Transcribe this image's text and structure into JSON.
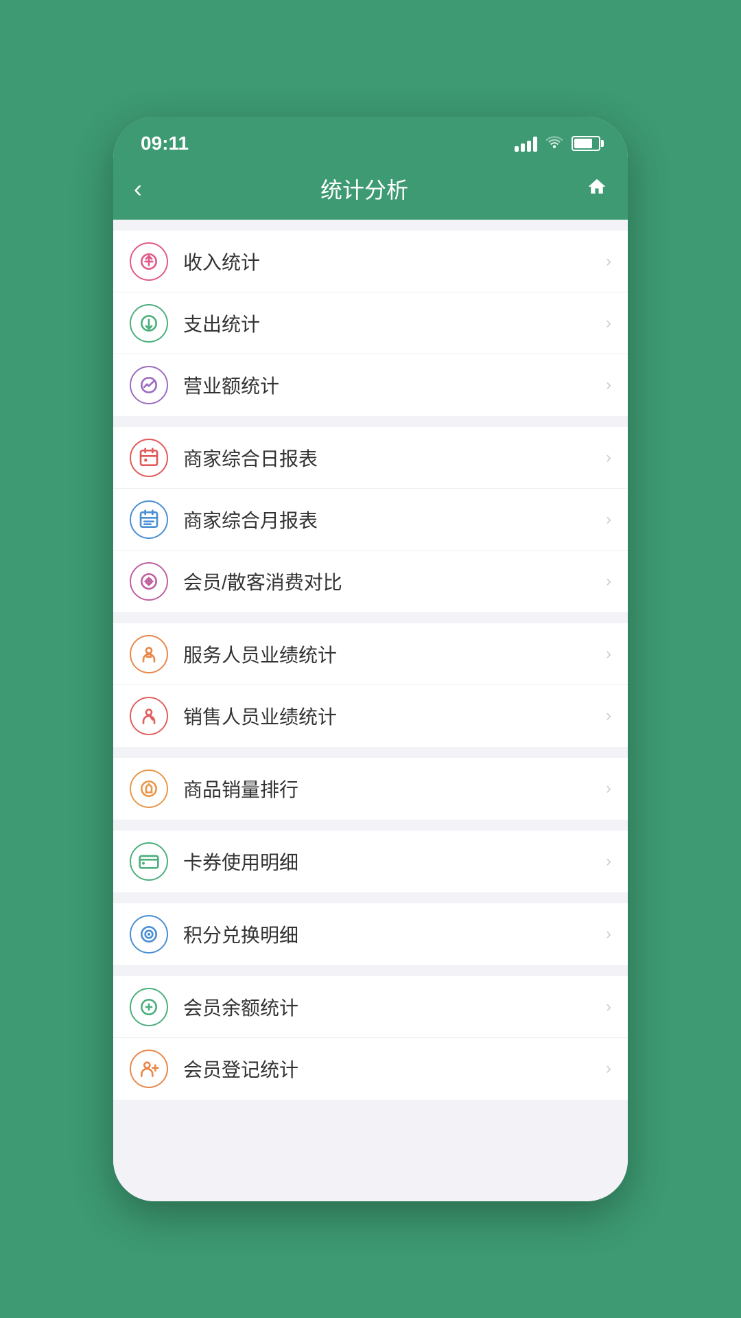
{
  "status_bar": {
    "time": "09:11",
    "signal": "signal",
    "wifi": "wifi",
    "battery": "battery"
  },
  "nav": {
    "title": "统计分析",
    "back_label": "‹",
    "home_label": "⌂"
  },
  "groups": [
    {
      "id": "group1",
      "items": [
        {
          "id": "income",
          "label": "收入统计",
          "icon_class": "icon-income",
          "icon_type": "income"
        },
        {
          "id": "expense",
          "label": "支出统计",
          "icon_class": "icon-expense",
          "icon_type": "expense"
        },
        {
          "id": "revenue",
          "label": "营业额统计",
          "icon_class": "icon-revenue",
          "icon_type": "revenue"
        }
      ]
    },
    {
      "id": "group2",
      "items": [
        {
          "id": "daily",
          "label": "商家综合日报表",
          "icon_class": "icon-daily",
          "icon_type": "daily"
        },
        {
          "id": "monthly",
          "label": "商家综合月报表",
          "icon_class": "icon-monthly",
          "icon_type": "monthly"
        },
        {
          "id": "member-compare",
          "label": "会员/散客消费对比",
          "icon_class": "icon-member-compare",
          "icon_type": "member-compare"
        }
      ]
    },
    {
      "id": "group3",
      "items": [
        {
          "id": "service-staff",
          "label": "服务人员业绩统计",
          "icon_class": "icon-service-staff",
          "icon_type": "service-staff"
        },
        {
          "id": "sales-staff",
          "label": "销售人员业绩统计",
          "icon_class": "icon-sales-staff",
          "icon_type": "sales-staff"
        }
      ]
    },
    {
      "id": "group4",
      "items": [
        {
          "id": "product-rank",
          "label": "商品销量排行",
          "icon_class": "icon-product-rank",
          "icon_type": "product-rank"
        }
      ]
    },
    {
      "id": "group5",
      "items": [
        {
          "id": "card",
          "label": "卡券使用明细",
          "icon_class": "icon-card",
          "icon_type": "card"
        }
      ]
    },
    {
      "id": "group6",
      "items": [
        {
          "id": "points",
          "label": "积分兑换明细",
          "icon_class": "icon-points",
          "icon_type": "points"
        }
      ]
    },
    {
      "id": "group7",
      "items": [
        {
          "id": "member-balance",
          "label": "会员余额统计",
          "icon_class": "icon-member-balance",
          "icon_type": "member-balance"
        },
        {
          "id": "member-register",
          "label": "会员登记统计",
          "icon_class": "icon-member-register",
          "icon_type": "member-register"
        }
      ]
    }
  ],
  "arrow": "›"
}
